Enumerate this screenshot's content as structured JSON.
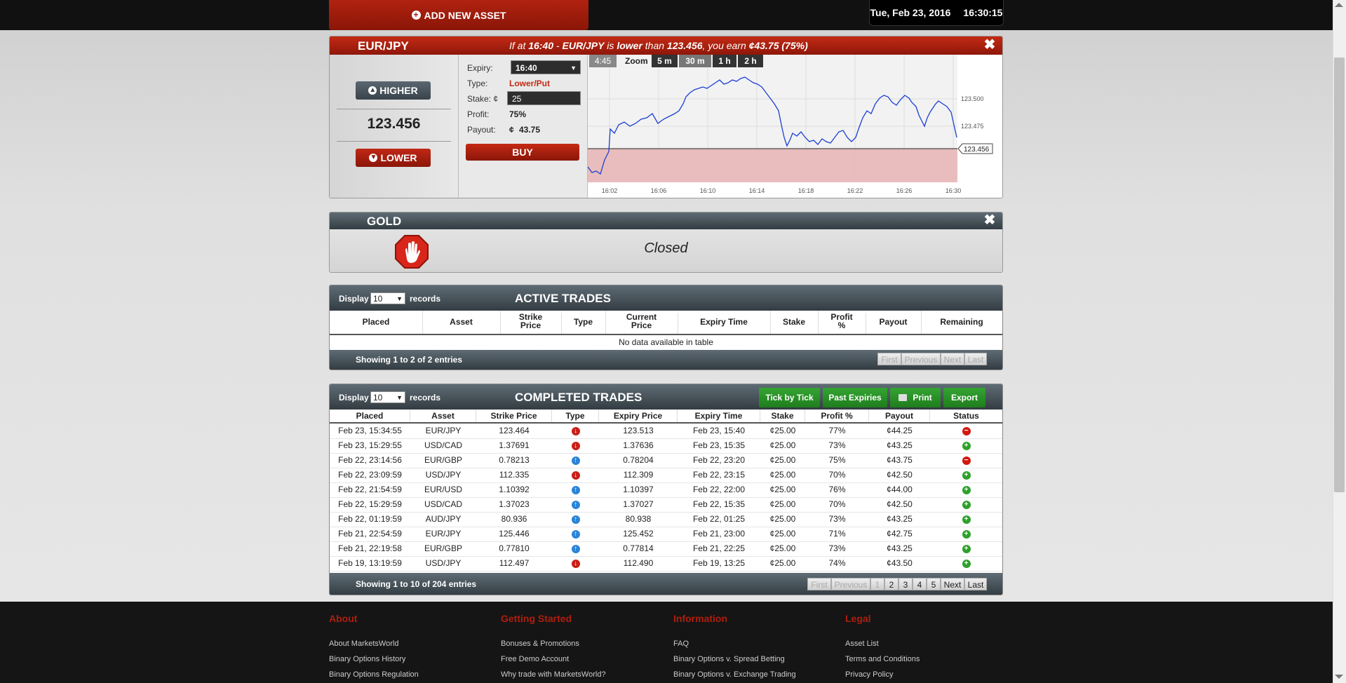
{
  "topbar": {
    "add_asset_label": "ADD NEW ASSET",
    "date": "Tue, Feb 23, 2016",
    "time": "16:30:15"
  },
  "asset_panel": {
    "asset": "EUR/JPY",
    "message": {
      "prefix": "If at ",
      "expiry": "16:40",
      "mid1": " - ",
      "asset": "EUR/JPY",
      "mid2": " is ",
      "direction": "lower",
      "mid3": " than ",
      "strike": "123.456",
      "mid4": ", you earn ",
      "earn": "¢43.75 (75%)"
    },
    "higher_label": "HIGHER",
    "lower_label": "LOWER",
    "current_price": "123.456",
    "expiry_label": "Expiry:",
    "expiry_value": "16:40",
    "type_label": "Type:",
    "type_value": "Lower/Put",
    "stake_label": "Stake: ¢",
    "stake_value": "25",
    "profit_label": "Profit:",
    "profit_value": "75%",
    "payout_label": "Payout:",
    "payout_currency": "¢",
    "payout_value": "43.75",
    "buy_label": "BUY",
    "chart": {
      "countdown": "4:45",
      "zoom_label": "Zoom",
      "zoom_options": [
        "5 m",
        "30 m",
        "1 h",
        "2 h"
      ],
      "zoom_selected": "30 m",
      "x_ticks": [
        "16:02",
        "16:06",
        "16:10",
        "16:14",
        "16:18",
        "16:22",
        "16:26",
        "16:30"
      ],
      "y_ticks": [
        "123.500",
        "123.475"
      ],
      "current_label": "123.456",
      "colors": {
        "line": "#1a3fd4",
        "lower_zone": "#e8b4b4"
      }
    }
  },
  "gold_panel": {
    "asset": "GOLD",
    "status": "Closed"
  },
  "active_trades": {
    "display_label": "Display",
    "records_value": "10",
    "records_label": "records",
    "title": "ACTIVE TRADES",
    "columns": [
      "Placed",
      "Asset",
      "Strike Price",
      "Type",
      "Current Price",
      "Expiry Time",
      "Stake",
      "Profit %",
      "Payout",
      "Remaining"
    ],
    "empty_text": "No data available in table",
    "showing": "Showing 1 to 2 of 2 entries",
    "pager": [
      "First",
      "Previous",
      "Next",
      "Last"
    ]
  },
  "completed_trades": {
    "display_label": "Display",
    "records_value": "10",
    "records_label": "records",
    "title": "COMPLETED TRADES",
    "buttons": {
      "tick": "Tick by Tick",
      "past": "Past Expiries",
      "print": "Print",
      "export": "Export"
    },
    "columns": [
      "Placed",
      "Asset",
      "Strike Price",
      "Type",
      "Expiry Price",
      "Expiry Time",
      "Stake",
      "Profit %",
      "Payout",
      "Status"
    ],
    "rows": [
      {
        "placed": "Feb 23, 15:34:55",
        "asset": "EUR/JPY",
        "strike": "123.464",
        "type": "down",
        "expiry_price": "123.513",
        "expiry_time": "Feb 23, 15:40",
        "stake": "¢25.00",
        "profit": "77%",
        "payout": "¢44.25",
        "status": "lose"
      },
      {
        "placed": "Feb 23, 15:29:55",
        "asset": "USD/CAD",
        "strike": "1.37691",
        "type": "down",
        "expiry_price": "1.37636",
        "expiry_time": "Feb 23, 15:35",
        "stake": "¢25.00",
        "profit": "73%",
        "payout": "¢43.25",
        "status": "win"
      },
      {
        "placed": "Feb 22, 23:14:56",
        "asset": "EUR/GBP",
        "strike": "0.78213",
        "type": "up",
        "expiry_price": "0.78204",
        "expiry_time": "Feb 22, 23:20",
        "stake": "¢25.00",
        "profit": "75%",
        "payout": "¢43.75",
        "status": "lose"
      },
      {
        "placed": "Feb 22, 23:09:59",
        "asset": "USD/JPY",
        "strike": "112.335",
        "type": "down",
        "expiry_price": "112.309",
        "expiry_time": "Feb 22, 23:15",
        "stake": "¢25.00",
        "profit": "70%",
        "payout": "¢42.50",
        "status": "win"
      },
      {
        "placed": "Feb 22, 21:54:59",
        "asset": "EUR/USD",
        "strike": "1.10392",
        "type": "up",
        "expiry_price": "1.10397",
        "expiry_time": "Feb 22, 22:00",
        "stake": "¢25.00",
        "profit": "76%",
        "payout": "¢44.00",
        "status": "win"
      },
      {
        "placed": "Feb 22, 15:29:59",
        "asset": "USD/CAD",
        "strike": "1.37023",
        "type": "up",
        "expiry_price": "1.37027",
        "expiry_time": "Feb 22, 15:35",
        "stake": "¢25.00",
        "profit": "70%",
        "payout": "¢42.50",
        "status": "win"
      },
      {
        "placed": "Feb 22, 01:19:59",
        "asset": "AUD/JPY",
        "strike": "80.936",
        "type": "up",
        "expiry_price": "80.938",
        "expiry_time": "Feb 22, 01:25",
        "stake": "¢25.00",
        "profit": "73%",
        "payout": "¢43.25",
        "status": "win"
      },
      {
        "placed": "Feb 21, 22:54:59",
        "asset": "EUR/JPY",
        "strike": "125.446",
        "type": "up",
        "expiry_price": "125.452",
        "expiry_time": "Feb 21, 23:00",
        "stake": "¢25.00",
        "profit": "71%",
        "payout": "¢42.75",
        "status": "win"
      },
      {
        "placed": "Feb 21, 22:19:58",
        "asset": "EUR/GBP",
        "strike": "0.77810",
        "type": "up",
        "expiry_price": "0.77814",
        "expiry_time": "Feb 21, 22:25",
        "stake": "¢25.00",
        "profit": "73%",
        "payout": "¢43.25",
        "status": "win"
      },
      {
        "placed": "Feb 19, 13:19:59",
        "asset": "USD/JPY",
        "strike": "112.497",
        "type": "down",
        "expiry_price": "112.490",
        "expiry_time": "Feb 19, 13:25",
        "stake": "¢25.00",
        "profit": "74%",
        "payout": "¢43.50",
        "status": "win"
      }
    ],
    "showing": "Showing 1 to 10 of 204 entries",
    "pager": [
      "First",
      "Previous",
      "1",
      "2",
      "3",
      "4",
      "5",
      "Next",
      "Last"
    ]
  },
  "footer": {
    "columns": [
      {
        "heading": "About",
        "links": [
          "About MarketsWorld",
          "Binary Options History",
          "Binary Options Regulation"
        ]
      },
      {
        "heading": "Getting Started",
        "links": [
          "Bonuses & Promotions",
          "Free Demo Account",
          "Why trade with MarketsWorld?"
        ]
      },
      {
        "heading": "Information",
        "links": [
          "FAQ",
          "Binary Options v. Spread Betting",
          "Binary Options v. Exchange Trading"
        ]
      },
      {
        "heading": "Legal",
        "links": [
          "Asset List",
          "Terms and Conditions",
          "Privacy Policy"
        ]
      }
    ]
  }
}
